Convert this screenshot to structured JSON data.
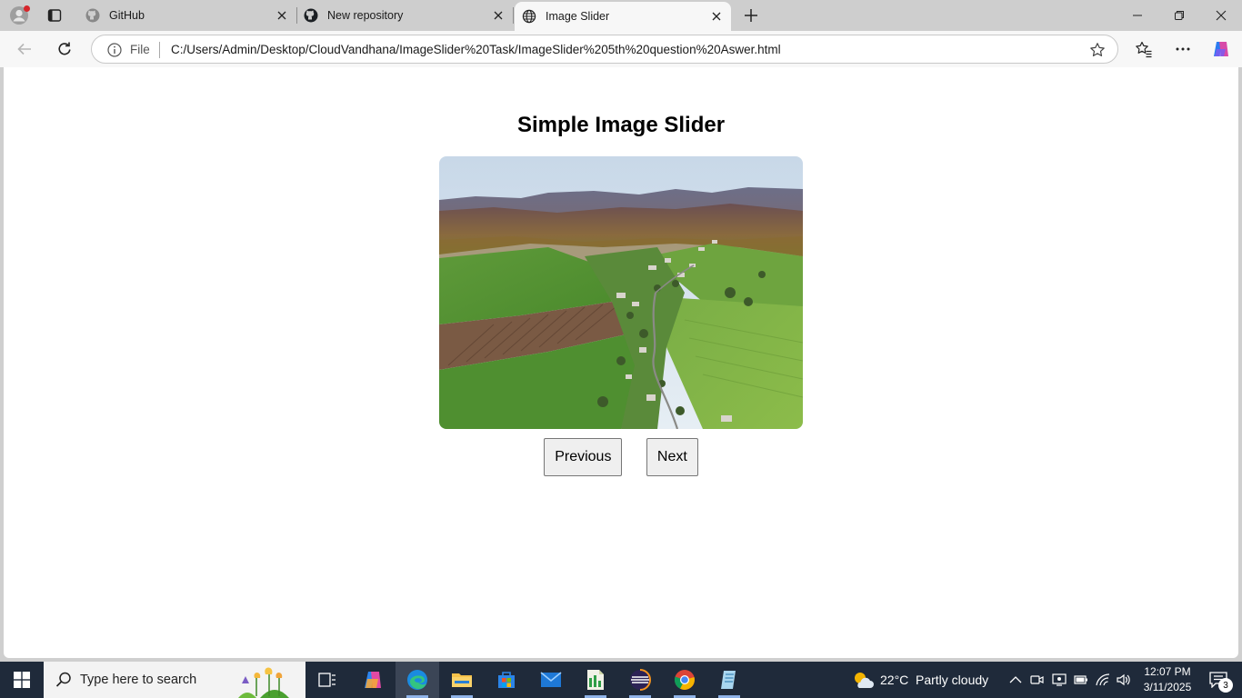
{
  "browser": {
    "tabs": [
      {
        "label": "GitHub",
        "icon": "github-icon",
        "active": false
      },
      {
        "label": "New repository",
        "icon": "github-icon",
        "active": false
      },
      {
        "label": "Image Slider",
        "icon": "globe-icon",
        "active": true
      }
    ],
    "address": {
      "scheme_label": "File",
      "url": "C:/Users/Admin/Desktop/CloudVandhana/ImageSlider%20Task/ImageSlider%205th%20question%20Aswer.html"
    }
  },
  "page": {
    "title": "Simple Image Slider",
    "image_alt": "Aerial view of a village among green fields and hills",
    "buttons": {
      "previous": "Previous",
      "next": "Next"
    }
  },
  "taskbar": {
    "search_placeholder": "Type here to search",
    "weather": {
      "temperature": "22°C",
      "condition": "Partly cloudy"
    },
    "clock": {
      "time": "12:07 PM",
      "date": "3/11/2025"
    },
    "notification_count": "3",
    "apps": [
      "task-view-icon",
      "copilot-icon",
      "edge-icon",
      "file-explorer-icon",
      "store-icon",
      "mail-icon",
      "spreadsheet-app-icon",
      "eclipse-icon",
      "chrome-icon",
      "notepad-icon"
    ]
  },
  "colors": {
    "taskbar_bg": "#1f2a3a",
    "tab_strip_bg": "#cecece",
    "page_bg": "#ffffff"
  }
}
